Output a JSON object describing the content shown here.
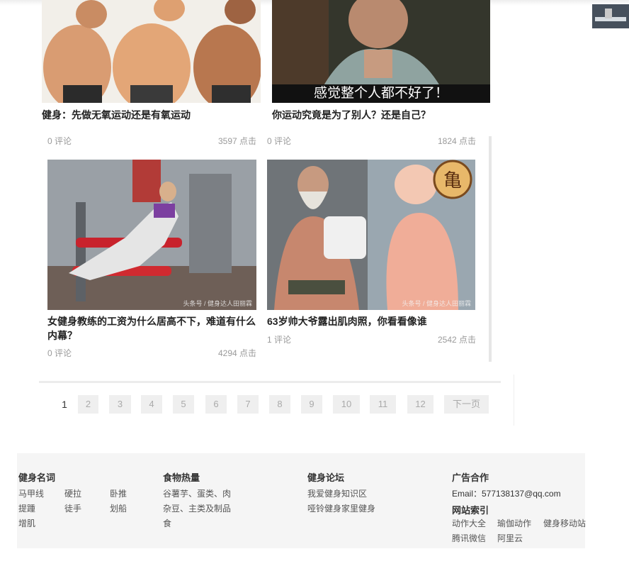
{
  "articles": [
    {
      "title": "健身：先做无氧运动还是有氧运动",
      "comments": "0 评论",
      "clicks": "3597 点击"
    },
    {
      "title": "你运动究竟是为了别人？还是自己？",
      "caption": "感觉整个人都不好了！",
      "comments": "0 评论",
      "clicks": "1824 点击"
    },
    {
      "title": "女健身教练的工资为什么居高不下，难道有什么内幕？",
      "watermark": "头条号 / 健身达人田丽霖",
      "comments": "0 评论",
      "clicks": "4294 点击"
    },
    {
      "title": "63岁帅大爷露出肌肉照，你看看像谁",
      "watermark": "头条号 / 健身达人田丽霖",
      "comments": "1 评论",
      "clicks": "2542 点击"
    }
  ],
  "pagination": {
    "pages": [
      "1",
      "2",
      "3",
      "4",
      "5",
      "6",
      "7",
      "8",
      "9",
      "10",
      "11",
      "12"
    ],
    "current": "1",
    "next": "下一页"
  },
  "footer": {
    "col1": {
      "heading": "健身名词",
      "links": [
        "马甲线",
        "硬拉",
        "卧推",
        "提踵",
        "徒手",
        "划船",
        "增肌"
      ]
    },
    "col2": {
      "heading": "食物热量",
      "links": [
        "谷薯芋、",
        "蛋类、肉",
        "杂豆、主",
        "类及制品",
        "食"
      ]
    },
    "col3": {
      "heading": "健身论坛",
      "links": [
        "我爱健身知识区",
        "哑铃健身家里健身"
      ]
    },
    "col4": {
      "heading": "广告合作",
      "email": "Email：577138137@qq.com",
      "heading2": "网站索引",
      "links": [
        "动作大全",
        "瑜伽动作",
        "健身移动站",
        "腾讯微信",
        "阿里云"
      ]
    }
  },
  "colors": {
    "page_bg": "#ffffff",
    "footer_bg": "#f5f5f5",
    "pager_bg": "#efefef"
  }
}
